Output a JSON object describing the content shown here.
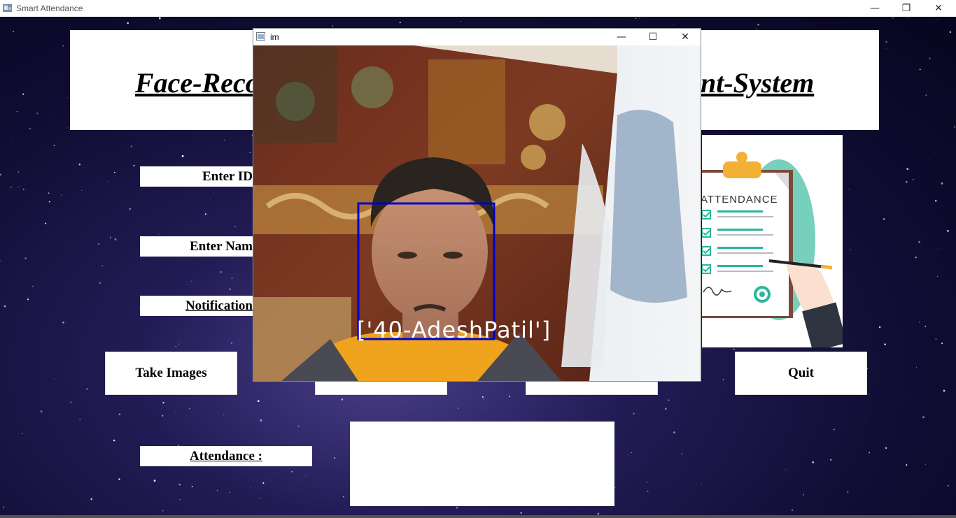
{
  "window": {
    "title": "Smart Attendance",
    "controls": {
      "minimize": "—",
      "restore": "❐",
      "close": "✕"
    }
  },
  "header": {
    "title_left": "Face-Reco",
    "title_right": "nt-System"
  },
  "form": {
    "enter_id_label": "Enter ID",
    "enter_name_label": "Enter Nam",
    "notification_label": "Notification",
    "attendance_label": "Attendance :",
    "attendance_value": ""
  },
  "buttons": {
    "take_images": "Take Images",
    "quit": "Quit"
  },
  "popup": {
    "title": "im",
    "controls": {
      "minimize": "—",
      "maximize": "☐",
      "close": "✕"
    },
    "face_label": "['40-AdeshPatil']",
    "face_box_color": "#0000cc"
  },
  "illustration": {
    "heading": "ATTENDANCE",
    "check_color": "#2bb59a",
    "clip_color": "#f2b035"
  }
}
